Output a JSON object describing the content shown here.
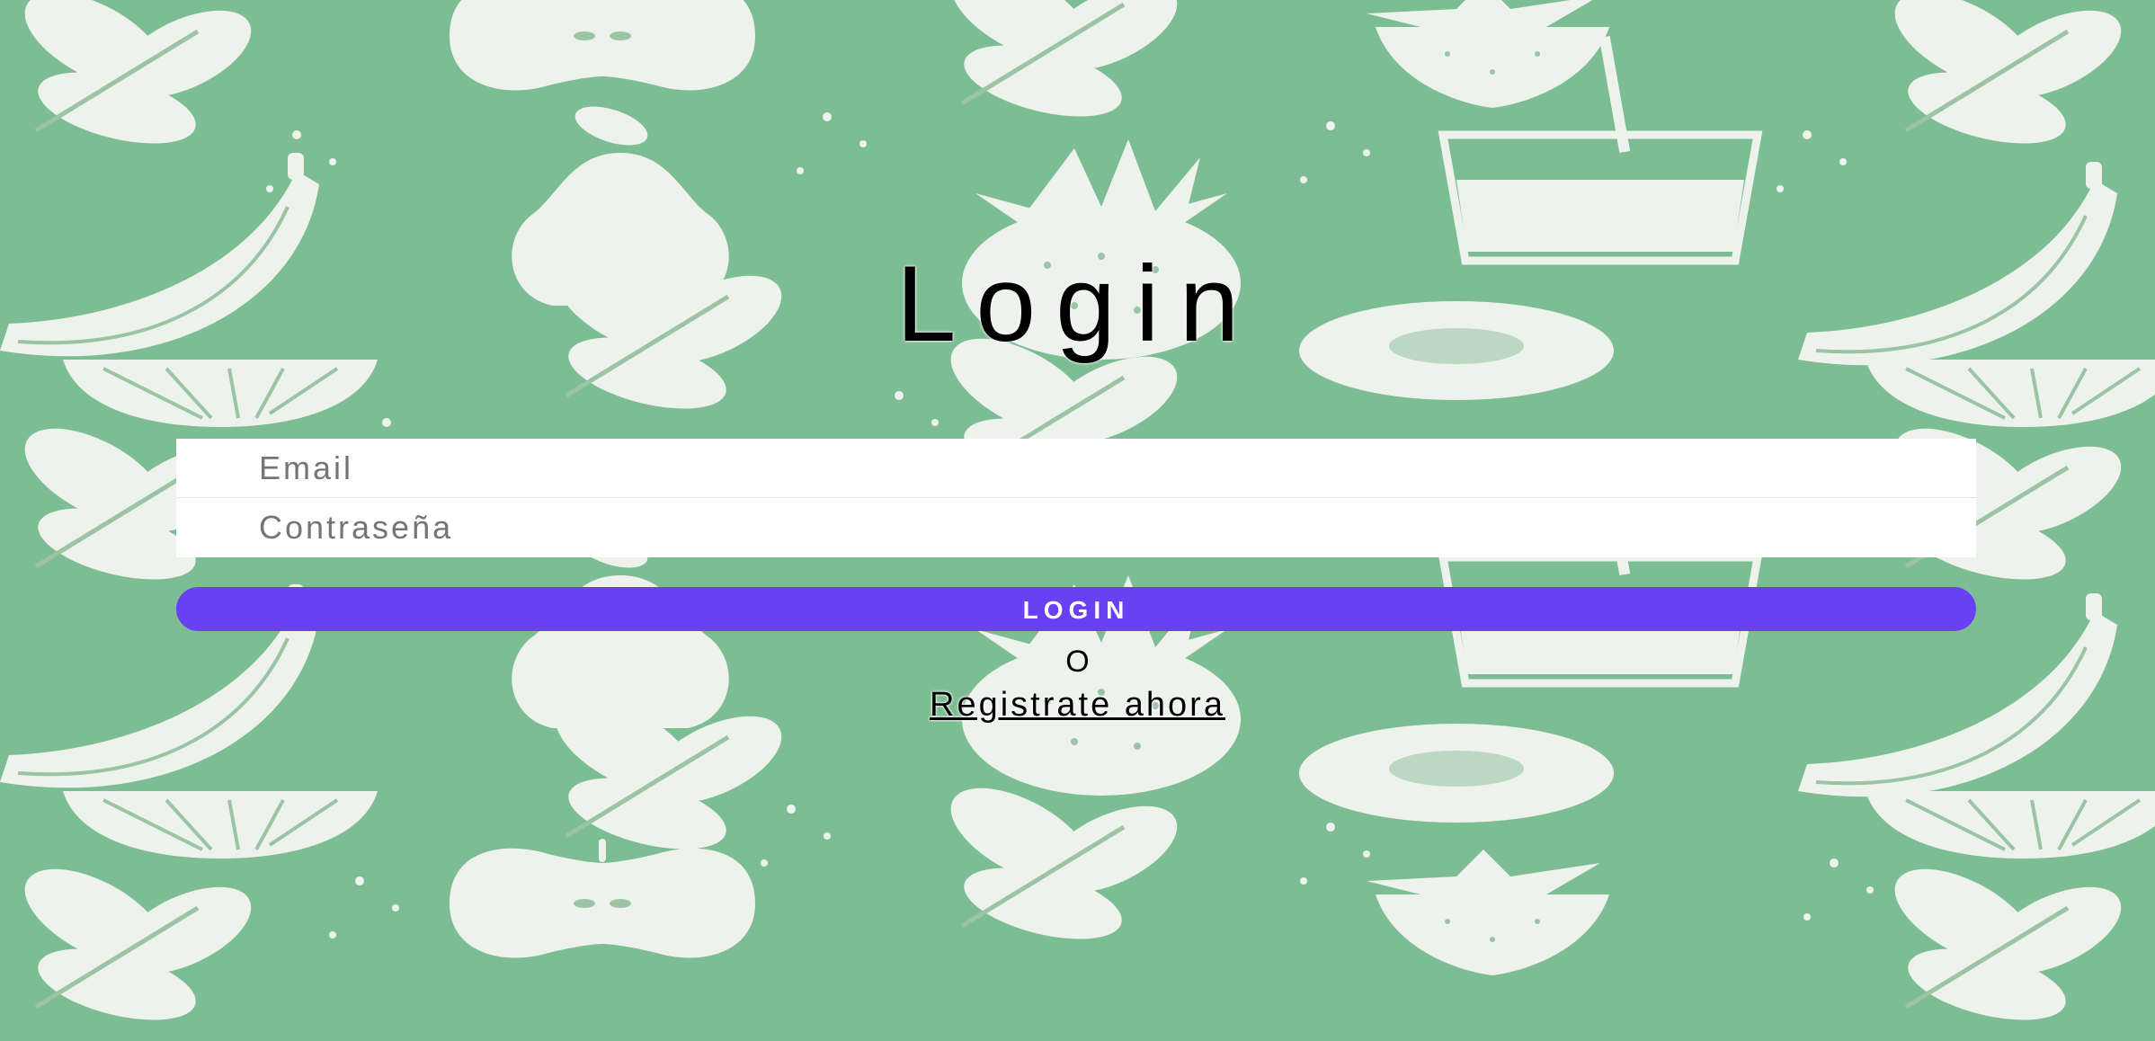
{
  "login": {
    "title": "Login",
    "email_placeholder": "Email",
    "password_placeholder": "Contraseña",
    "button_label": "LOGIN",
    "separator": "O",
    "register_link": "Registrate ahora"
  },
  "theme": {
    "background_color": "#7dbd93",
    "pattern_color": "#f1f4f0",
    "button_color": "#6a40f5",
    "input_background": "#ffffff"
  },
  "background": {
    "pattern_items": [
      "leaf-icon",
      "apple-icon",
      "banana-icon",
      "pineapple-icon",
      "strawberry-icon",
      "pear-icon",
      "lemon-icon",
      "kiwi-icon",
      "juice-glass-icon"
    ]
  }
}
